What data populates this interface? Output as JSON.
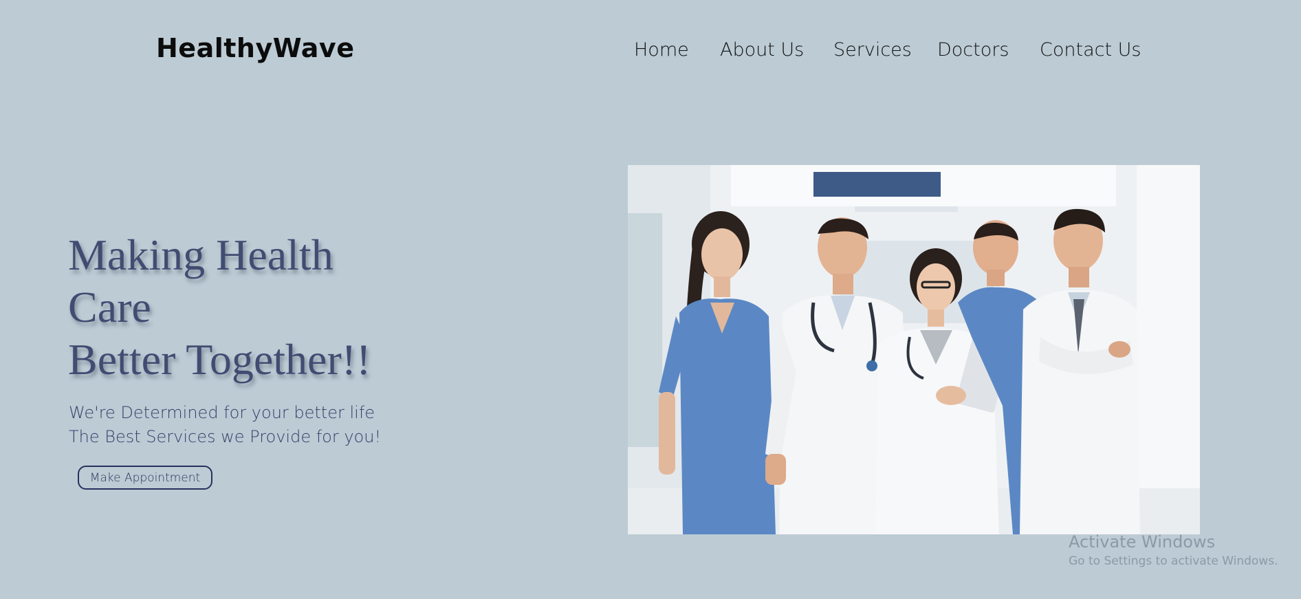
{
  "brand": {
    "name": "HealthyWave"
  },
  "nav": {
    "items": [
      {
        "label": "Home"
      },
      {
        "label": "About Us"
      },
      {
        "label": "Services"
      },
      {
        "label": "Doctors"
      },
      {
        "label": "Contact Us"
      }
    ]
  },
  "hero": {
    "headline_line1": "Making Health",
    "headline_line2": "Care",
    "headline_line3": "Better Together!!",
    "sub_line1": "We're Determined for your better life",
    "sub_line2": "The Best Services we Provide for you!",
    "cta_label": "Make Appointment",
    "image_alt": "Group of smiling doctors and nurses in a hospital corridor"
  },
  "watermark": {
    "title": "Activate Windows",
    "subtitle": "Go to Settings to activate Windows."
  },
  "colors": {
    "background": "#bccbd4",
    "headline": "#414c72",
    "scrubs": "#5b88c4",
    "cta_border": "#26315c"
  }
}
